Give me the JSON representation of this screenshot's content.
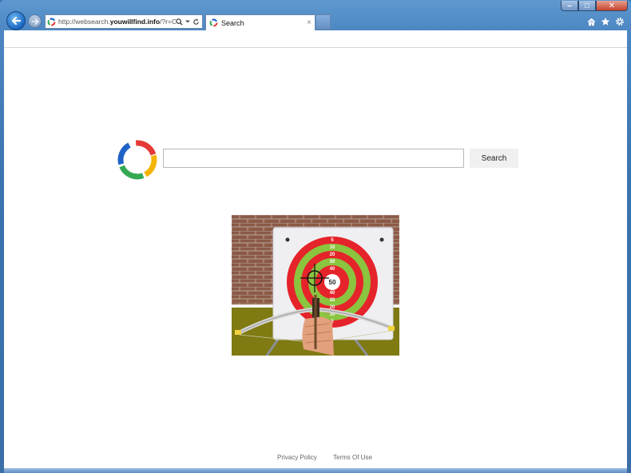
{
  "browser": {
    "address": {
      "url_prefix": "http://websearch.",
      "url_domain": "youwillfind.info",
      "url_suffix": "/?r=C"
    },
    "tab": {
      "label": "Search",
      "close": "×"
    },
    "window_controls": {
      "minimize": "–",
      "maximize": "□",
      "close": "✕"
    }
  },
  "page": {
    "search": {
      "value": "",
      "placeholder": "",
      "button_label": "Search"
    },
    "footer": {
      "privacy": "Privacy Policy",
      "terms": "Terms Of Use"
    },
    "target_rings": [
      "5",
      "10",
      "20",
      "30",
      "40",
      "50",
      "40",
      "30",
      "20",
      "10",
      "5"
    ]
  },
  "colors": {
    "ring_red": "#e5232a",
    "ring_green": "#8bc43f",
    "brick": "#8c5a45",
    "ground": "#7f7a12",
    "logo_red": "#e53935",
    "logo_yellow": "#f4b400",
    "logo_green": "#34a853",
    "logo_blue": "#1e63c6"
  }
}
